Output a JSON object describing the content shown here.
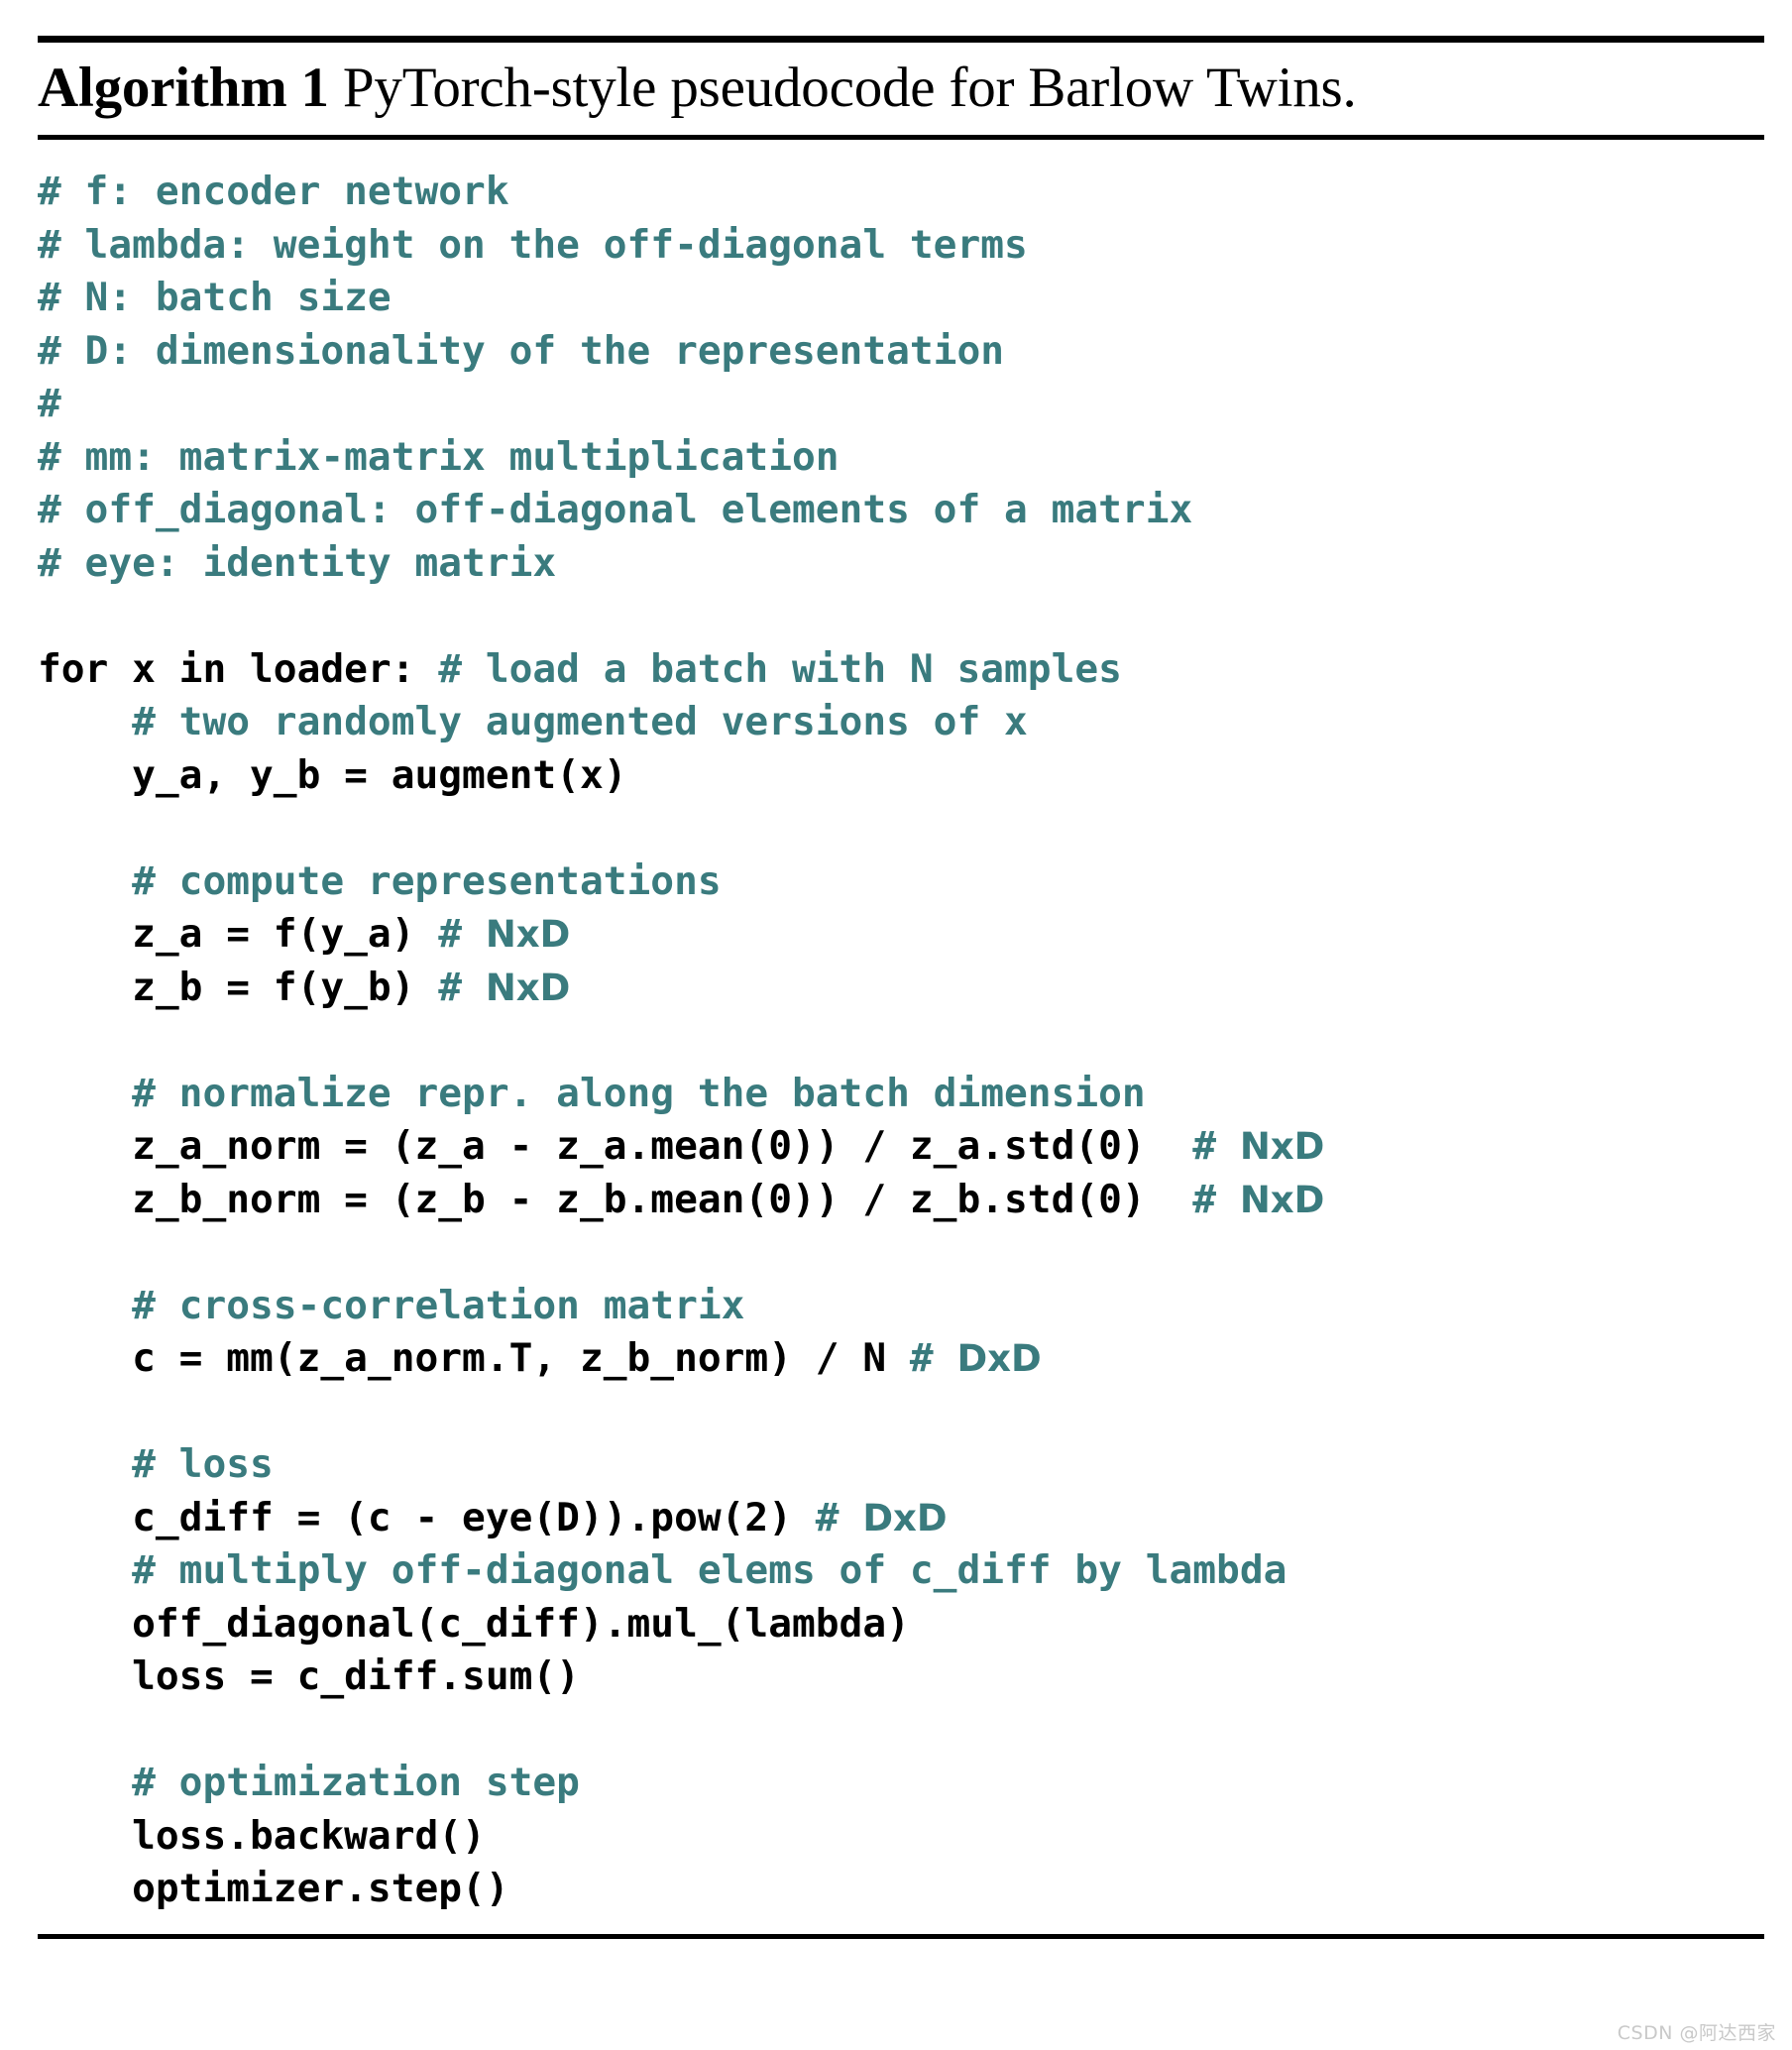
{
  "document": {
    "background_color": "#ffffff",
    "rule_color": "#000000"
  },
  "title": {
    "label": "Algorithm 1",
    "caption": " PyTorch-style pseudocode for Barlow Twins."
  },
  "colors": {
    "comment": "#3a7b7e",
    "code": "#000000",
    "watermark": "#c9c9c9"
  },
  "code": {
    "lines": [
      {
        "segments": [
          {
            "kind": "comment",
            "text": "# f: encoder network"
          }
        ]
      },
      {
        "segments": [
          {
            "kind": "comment",
            "text": "# lambda: weight on the off-diagonal terms"
          }
        ]
      },
      {
        "segments": [
          {
            "kind": "comment",
            "text": "# N: batch size"
          }
        ]
      },
      {
        "segments": [
          {
            "kind": "comment",
            "text": "# D: dimensionality of the representation"
          }
        ]
      },
      {
        "segments": [
          {
            "kind": "comment",
            "text": "#"
          }
        ]
      },
      {
        "segments": [
          {
            "kind": "comment",
            "text": "# mm: matrix-matrix multiplication"
          }
        ]
      },
      {
        "segments": [
          {
            "kind": "comment",
            "text": "# off_diagonal: off-diagonal elements of a matrix"
          }
        ]
      },
      {
        "segments": [
          {
            "kind": "comment",
            "text": "# eye: identity matrix"
          }
        ]
      },
      {
        "segments": []
      },
      {
        "segments": [
          {
            "kind": "code",
            "text": "for x in loader: "
          },
          {
            "kind": "comment",
            "text": "# load a batch with N samples"
          }
        ]
      },
      {
        "segments": [
          {
            "kind": "comment",
            "text": "    # two randomly augmented versions of x"
          }
        ]
      },
      {
        "segments": [
          {
            "kind": "code",
            "text": "    y_a, y_b = augment(x)"
          }
        ]
      },
      {
        "segments": []
      },
      {
        "segments": [
          {
            "kind": "comment",
            "text": "    # compute representations"
          }
        ]
      },
      {
        "segments": [
          {
            "kind": "code",
            "text": "    z_a = f(y_a) "
          },
          {
            "kind": "comment",
            "text": "# "
          },
          {
            "kind": "dim",
            "text": "NxD"
          }
        ]
      },
      {
        "segments": [
          {
            "kind": "code",
            "text": "    z_b = f(y_b) "
          },
          {
            "kind": "comment",
            "text": "# "
          },
          {
            "kind": "dim",
            "text": "NxD"
          }
        ]
      },
      {
        "segments": []
      },
      {
        "segments": [
          {
            "kind": "comment",
            "text": "    # normalize repr. along the batch dimension"
          }
        ]
      },
      {
        "segments": [
          {
            "kind": "code",
            "text": "    z_a_norm = (z_a - z_a.mean(0)) / z_a.std(0)  "
          },
          {
            "kind": "comment",
            "text": "# "
          },
          {
            "kind": "dim",
            "text": "NxD"
          }
        ]
      },
      {
        "segments": [
          {
            "kind": "code",
            "text": "    z_b_norm = (z_b - z_b.mean(0)) / z_b.std(0)  "
          },
          {
            "kind": "comment",
            "text": "# "
          },
          {
            "kind": "dim",
            "text": "NxD"
          }
        ]
      },
      {
        "segments": []
      },
      {
        "segments": [
          {
            "kind": "comment",
            "text": "    # cross-correlation matrix"
          }
        ]
      },
      {
        "segments": [
          {
            "kind": "code",
            "text": "    c = mm(z_a_norm.T, z_b_norm) / N "
          },
          {
            "kind": "comment",
            "text": "# "
          },
          {
            "kind": "dim",
            "text": "DxD"
          }
        ]
      },
      {
        "segments": []
      },
      {
        "segments": [
          {
            "kind": "comment",
            "text": "    # loss"
          }
        ]
      },
      {
        "segments": [
          {
            "kind": "code",
            "text": "    c_diff = (c - eye(D)).pow(2) "
          },
          {
            "kind": "comment",
            "text": "# "
          },
          {
            "kind": "dim",
            "text": "DxD"
          }
        ]
      },
      {
        "segments": [
          {
            "kind": "comment",
            "text": "    # multiply off-diagonal elems of c_diff by lambda"
          }
        ]
      },
      {
        "segments": [
          {
            "kind": "code",
            "text": "    off_diagonal(c_diff).mul_(lambda)"
          }
        ]
      },
      {
        "segments": [
          {
            "kind": "code",
            "text": "    loss = c_diff.sum()"
          }
        ]
      },
      {
        "segments": []
      },
      {
        "segments": [
          {
            "kind": "comment",
            "text": "    # optimization step"
          }
        ]
      },
      {
        "segments": [
          {
            "kind": "code",
            "text": "    loss.backward()"
          }
        ]
      },
      {
        "segments": [
          {
            "kind": "code",
            "text": "    optimizer.step()"
          }
        ]
      }
    ]
  },
  "watermark": {
    "text": "CSDN @阿达西家"
  }
}
